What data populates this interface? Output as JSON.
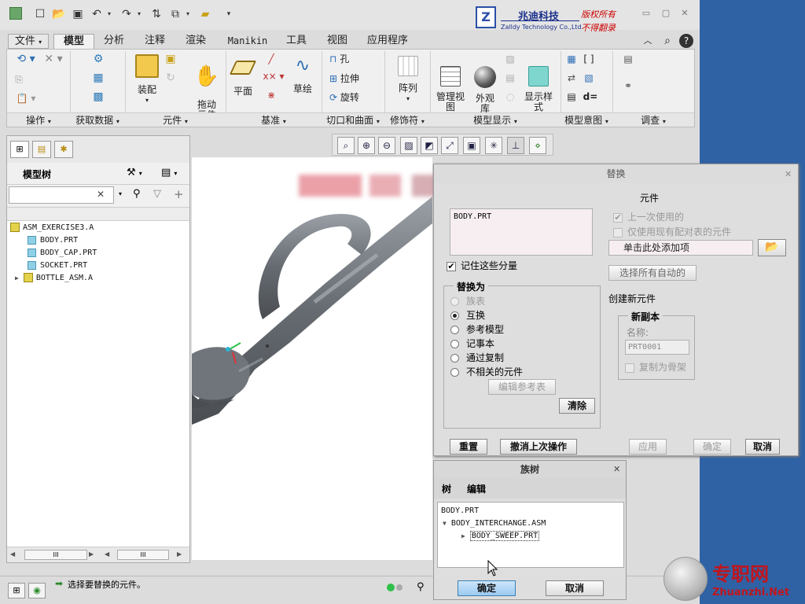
{
  "brand": {
    "logo_letter": "Z",
    "name_cn": "兆迪科技",
    "name_en": "Zalldy Technology Co.,Ltd.",
    "rights_line1": "版权所有",
    "rights_line2": "不得翻录"
  },
  "menu_tabs": [
    {
      "label": "文件",
      "active": false
    },
    {
      "label": "模型",
      "active": true
    },
    {
      "label": "分析",
      "active": false
    },
    {
      "label": "注释",
      "active": false
    },
    {
      "label": "渲染",
      "active": false
    },
    {
      "label": "Manikin",
      "active": false
    },
    {
      "label": "工具",
      "active": false
    },
    {
      "label": "视图",
      "active": false
    },
    {
      "label": "应用程序",
      "active": false
    }
  ],
  "ribbon": {
    "groups": [
      "操作",
      "获取数据",
      "元件",
      "基准",
      "切口和曲面",
      "修饰符",
      "模型显示",
      "模型意图",
      "调查"
    ],
    "buttons": {
      "assemble": "装配",
      "drag_components": "拖动\n元件",
      "plane": "平面",
      "sketch": "草绘",
      "hole": "孔",
      "extrude": "拉伸",
      "revolve": "旋转",
      "pattern": "阵列",
      "manage_views": "管理视\n图",
      "appearance_gallery": "外观\n库",
      "display_style": "显示样\n式"
    }
  },
  "model_tree": {
    "title": "模型树",
    "search_value": "",
    "items": [
      {
        "label": "ASM_EXERCISE3.A",
        "type": "asm",
        "level": 0,
        "expandable": false
      },
      {
        "label": "BODY.PRT",
        "type": "part",
        "level": 1,
        "expandable": false
      },
      {
        "label": "BODY_CAP.PRT",
        "type": "part",
        "level": 1,
        "expandable": false
      },
      {
        "label": "SOCKET.PRT",
        "type": "part",
        "level": 1,
        "expandable": false
      },
      {
        "label": "BOTTLE_ASM.A",
        "type": "asm",
        "level": 1,
        "expandable": true
      }
    ],
    "hscroll_grip": "III"
  },
  "status": {
    "message": "选择要替换的元件。"
  },
  "substitute_dialog": {
    "title": "替换",
    "header_partial": "元件",
    "selected_part": "BODY.PRT",
    "remember_selection": {
      "label": "记住这些分量",
      "checked": true
    },
    "replace_with": {
      "legend": "替换为",
      "options": [
        {
          "label": "族表",
          "selected": false,
          "enabled": false
        },
        {
          "label": "互换",
          "selected": true,
          "enabled": true
        },
        {
          "label": "参考模型",
          "selected": false,
          "enabled": true
        },
        {
          "label": "记事本",
          "selected": false,
          "enabled": true
        },
        {
          "label": "通过复制",
          "selected": false,
          "enabled": true
        },
        {
          "label": "不相关的元件",
          "selected": false,
          "enabled": true
        }
      ],
      "edit_ref_table": "编辑参考表",
      "clear": "清除"
    },
    "last_used": {
      "label": "上一次使用的",
      "checked": true,
      "enabled": false
    },
    "only_paired": {
      "label": "仅使用现有配对表的元件",
      "checked": false,
      "enabled": false
    },
    "add_item_placeholder": "单击此处添加项",
    "select_all_auto": "选择所有自动的",
    "create_new_component": "创建新元件",
    "new_copy": {
      "legend": "新副本",
      "name_label": "名称:",
      "name_value": "PRT0001",
      "copy_as_skeleton": "复制为骨架"
    },
    "buttons": {
      "reset": "重置",
      "undo_last": "撤消上次操作",
      "apply": "应用",
      "ok": "确定",
      "cancel": "取消"
    }
  },
  "family_tree_dialog": {
    "title": "族树",
    "menu": [
      "树",
      "编辑"
    ],
    "tree": [
      {
        "label": "BODY.PRT",
        "level": 0,
        "arrow": ""
      },
      {
        "label": "BODY_INTERCHANGE.ASM",
        "level": 1,
        "arrow": "▼"
      },
      {
        "label": "BODY_SWEEP.PRT",
        "level": 2,
        "arrow": "▶"
      }
    ],
    "buttons": {
      "ok": "确定",
      "cancel": "取消"
    }
  },
  "watermark": {
    "cn": "专职网",
    "en": "Zhuanzhi.Net"
  },
  "colors": {
    "desktop": "#2f62a4",
    "app_bg": "#dcdcdc",
    "model_gray": "#6d7278",
    "watermark_red": "#c0151d"
  }
}
